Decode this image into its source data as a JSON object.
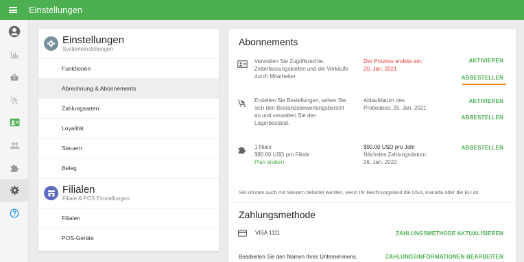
{
  "app": {
    "title": "Einstellungen"
  },
  "colors": {
    "primary": "#4caf50",
    "accent_underline": "#f57c00",
    "error": "#e53935"
  },
  "rail": {
    "items": [
      {
        "icon": "account-circle-icon"
      },
      {
        "icon": "bar-chart-icon"
      },
      {
        "icon": "basket-icon"
      },
      {
        "icon": "inventory-cart-icon"
      },
      {
        "icon": "id-card-icon"
      },
      {
        "icon": "people-icon"
      },
      {
        "icon": "puzzle-icon"
      },
      {
        "icon": "gear-icon",
        "active": true
      },
      {
        "icon": "help-circle-icon"
      }
    ]
  },
  "settings_nav": {
    "section1": {
      "title": "Einstellungen",
      "subtitle": "Systemeinstellungen",
      "icon": "gear-icon"
    },
    "section1_items": [
      {
        "label": "Funktionen"
      },
      {
        "label": "Abrechnung & Abonnements",
        "active": true
      },
      {
        "label": "Zahlungsarten"
      },
      {
        "label": "Loyalität"
      },
      {
        "label": "Steuern"
      },
      {
        "label": "Beleg"
      }
    ],
    "section2": {
      "title": "Filialen",
      "subtitle": "Filiale & POS Einstellungen",
      "icon": "store-icon"
    },
    "section2_items": [
      {
        "label": "Filialen"
      },
      {
        "label": "POS-Geräte"
      }
    ]
  },
  "subscriptions": {
    "title": "Abonnements",
    "rows": [
      {
        "icon": "id-card-icon",
        "desc": [
          "Verwalten Sie Zugriffsrechte,",
          "Zeiterfassungskarten und die Verkäufe",
          "durch Mitarbeiter."
        ],
        "status": [
          "Der Prozess endete am:",
          "20. Jan. 2021"
        ],
        "actions": [
          "AKTIVIEREN",
          "ABBESTELLEN"
        ]
      },
      {
        "icon": "inventory-cart-icon",
        "desc": [
          "Erstellen Sie Bestellungen, sehen Sie",
          "sich den Bestandsbewertungsbericht",
          "an und verwalten Sie den",
          "Lagerbestand."
        ],
        "status": [
          "Ablaufdatum des",
          "Probeabos: 28. Jan. 2021"
        ],
        "actions": [
          "AKTIVIEREN",
          "ABBESTELLEN"
        ]
      },
      {
        "icon": "puzzle-icon",
        "desc": [
          "1 filiale",
          "$90.00 USD pro Filiale"
        ],
        "link": "Plan ändern",
        "status": [
          "$90.00 USD pro Jahr",
          "Nächstes Zahlungsdatum:",
          "26. Jan. 2022"
        ],
        "actions": [
          "ABBESTELLEN"
        ]
      }
    ],
    "tax_note": "Sie können auch mit Steuern belastet werden, wenn Ihr Rechnungsland die USA, Kanada oder die EU ist."
  },
  "payment": {
    "title": "Zahlungsmethode",
    "card_icon": "credit-card-icon",
    "card_text": "VISA 1111",
    "update_action": "ZAHLUNGSMETHODE AKTUALISIEREN",
    "company_text": "Bearbeiten Sie den Namen Ihres Unternehmens,",
    "edit_action": "ZAHLUNGSINFORMATIONEN BEARBEITEN"
  }
}
